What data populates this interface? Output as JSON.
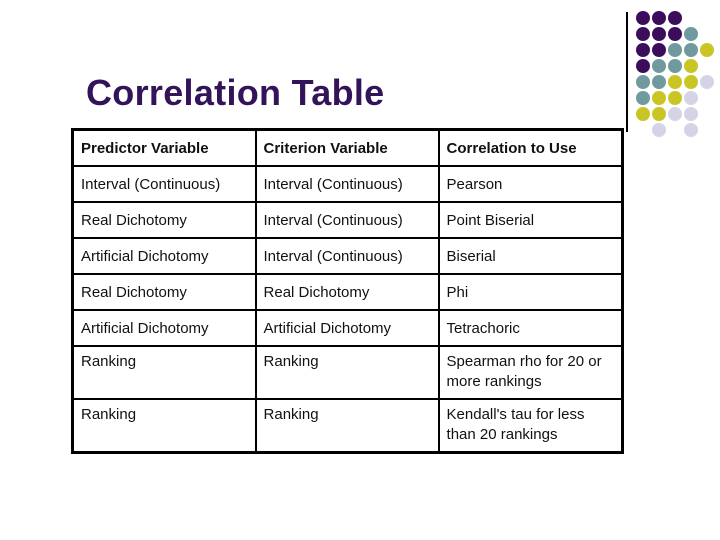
{
  "title": "Correlation Table",
  "colors": {
    "title": "#33135a",
    "dot_purple": "#3b0d5c",
    "dot_teal": "#6f9a9e",
    "dot_yellow": "#c9c524",
    "dot_lavender": "#d4d4e6"
  },
  "decoration": {
    "dot_grid": [
      [
        "P",
        "P",
        "P",
        "",
        ""
      ],
      [
        "P",
        "P",
        "P",
        "T",
        ""
      ],
      [
        "P",
        "P",
        "T",
        "T",
        "Y"
      ],
      [
        "P",
        "T",
        "T",
        "Y",
        ""
      ],
      [
        "T",
        "T",
        "Y",
        "Y",
        "L"
      ],
      [
        "T",
        "Y",
        "Y",
        "L",
        ""
      ],
      [
        "Y",
        "Y",
        "L",
        "L",
        ""
      ],
      [
        "",
        "L",
        "",
        "L",
        ""
      ]
    ]
  },
  "table": {
    "headers": [
      "Predictor Variable",
      "Criterion Variable",
      "Correlation to Use"
    ],
    "rows": [
      [
        "Interval (Continuous)",
        "Interval (Continuous)",
        "Pearson"
      ],
      [
        "Real Dichotomy",
        "Interval (Continuous)",
        "Point Biserial"
      ],
      [
        "Artificial Dichotomy",
        "Interval (Continuous)",
        "Biserial"
      ],
      [
        "Real Dichotomy",
        "Real Dichotomy",
        "Phi"
      ],
      [
        "Artificial Dichotomy",
        "Artificial Dichotomy",
        "Tetrachoric"
      ],
      [
        "Ranking",
        "Ranking",
        "Spearman rho for 20 or more rankings"
      ],
      [
        "Ranking",
        "Ranking",
        "Kendall's tau for less than 20 rankings"
      ]
    ]
  }
}
